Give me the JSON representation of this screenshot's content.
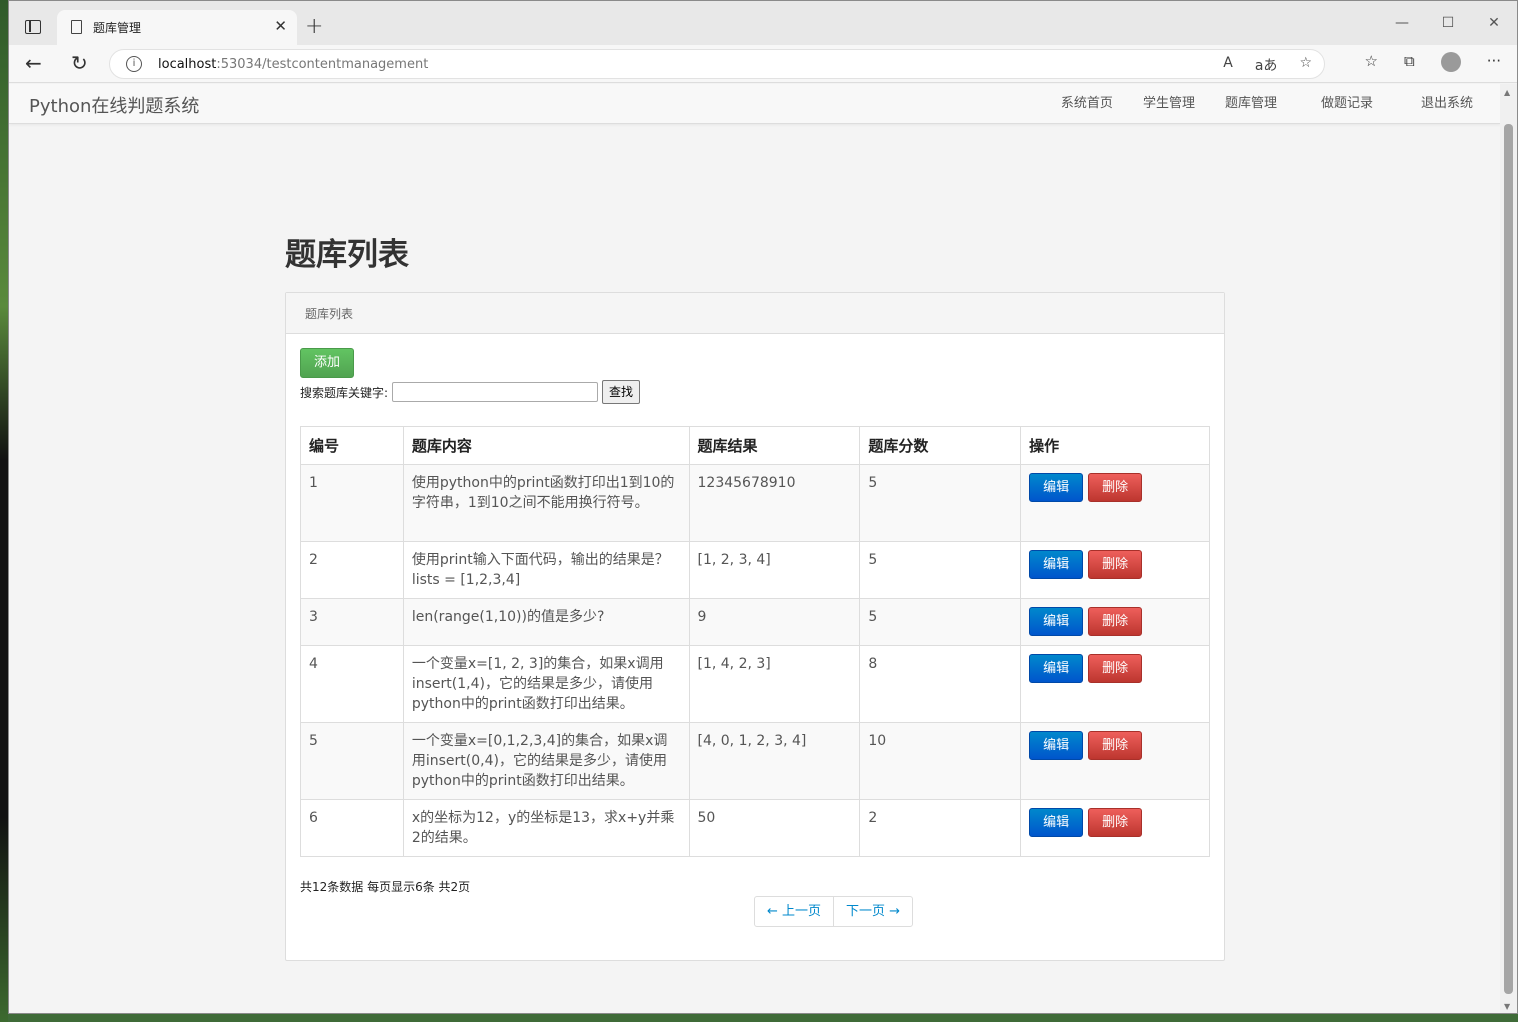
{
  "browser": {
    "tab_title": "题库管理",
    "close_glyph": "✕",
    "new_tab_glyph": "+",
    "url_host": "localhost",
    "url_rest": ":53034/testcontentmanagement",
    "win_min": "—",
    "win_max": "☐",
    "win_close": "✕",
    "back_glyph": "←",
    "reload_glyph": "↻",
    "info_glyph": "i",
    "read_aloud": "A",
    "translate": "aあ",
    "favorite": "☆",
    "favorites_bar": "☆",
    "collections": "⧉",
    "menu": "···"
  },
  "navbar": {
    "brand": "Python在线判题系统",
    "links": [
      "系统首页",
      "学生管理",
      "题库管理",
      "做题记录",
      "退出系统"
    ]
  },
  "page": {
    "title": "题库列表",
    "panel_heading": "题库列表",
    "add_button": "添加",
    "search_label": "搜索题库关键字:",
    "search_value": "",
    "search_button": "查找"
  },
  "table": {
    "headers": [
      "编号",
      "题库内容",
      "题库结果",
      "题库分数",
      "操作"
    ],
    "rows": [
      {
        "id": "1",
        "content": "使用python中的print函数打印出1到10的字符串，1到10之间不能用换行符号。",
        "result": "12345678910",
        "score": "5"
      },
      {
        "id": "2",
        "content": "使用print输入下面代码，输出的结果是？ lists = [1,2,3,4]",
        "result": "[1, 2, 3, 4]",
        "score": "5"
      },
      {
        "id": "3",
        "content": "len(range(1,10))的值是多少?",
        "result": "9",
        "score": "5"
      },
      {
        "id": "4",
        "content": "一个变量x=[1, 2, 3]的集合，如果x调用insert(1,4)，它的结果是多少，请使用python中的print函数打印出结果。",
        "result": "[1, 4, 2, 3]",
        "score": "8"
      },
      {
        "id": "5",
        "content": "一个变量x=[0,1,2,3,4]的集合，如果x调用insert(0,4)，它的结果是多少，请使用python中的print函数打印出结果。",
        "result": "[4, 0, 1, 2, 3, 4]",
        "score": "10"
      },
      {
        "id": "6",
        "content": "x的坐标为12，y的坐标是13，求x+y并乘2的结果。",
        "result": "50",
        "score": "2"
      }
    ],
    "edit_label": "编辑",
    "delete_label": "删除"
  },
  "pagination": {
    "info": "共12条数据 每页显示6条 共2页",
    "prev": "← 上一页",
    "next": "下一页 →"
  }
}
